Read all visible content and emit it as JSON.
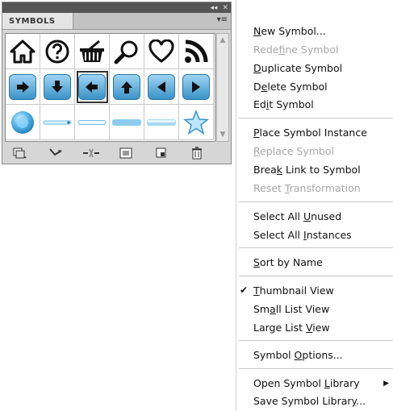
{
  "panel": {
    "chrome_controls": [
      "◂◂",
      "✕"
    ],
    "tab_label": "SYMBOLS",
    "menu_glyph": "▾≡"
  },
  "symbols": [
    "home-icon",
    "help-icon",
    "basket-icon",
    "magnifier-icon",
    "heart-icon",
    "rss-icon",
    "arrow-right-button",
    "arrow-down-button",
    "arrow-left-button",
    "arrow-up-button",
    "triangle-left-button",
    "triangle-right-button",
    "orb-symbol",
    "thin-line-dot",
    "thin-line",
    "thick-bar",
    "thick-bar-gloss",
    "star-symbol"
  ],
  "toolbar": [
    "library-icon",
    "place-icon",
    "break-link-icon",
    "options-icon",
    "new-icon",
    "delete-icon"
  ],
  "menu": {
    "groups": [
      [
        {
          "pre": "",
          "ul": "N",
          "post": "ew Symbol...",
          "disabled": false
        },
        {
          "pre": "Rede",
          "ul": "f",
          "post": "ine Symbol",
          "disabled": true
        },
        {
          "pre": "",
          "ul": "D",
          "post": "uplicate Symbol",
          "disabled": false
        },
        {
          "pre": "D",
          "ul": "e",
          "post": "lete Symbol",
          "disabled": false
        },
        {
          "pre": "Ed",
          "ul": "i",
          "post": "t Symbol",
          "disabled": false
        }
      ],
      [
        {
          "pre": "",
          "ul": "P",
          "post": "lace Symbol Instance",
          "disabled": false
        },
        {
          "pre": "",
          "ul": "R",
          "post": "eplace Symbol",
          "disabled": true
        },
        {
          "pre": "Brea",
          "ul": "k",
          "post": " Link to Symbol",
          "disabled": false
        },
        {
          "pre": "Reset ",
          "ul": "T",
          "post": "ransformation",
          "disabled": true
        }
      ],
      [
        {
          "pre": "Select All ",
          "ul": "U",
          "post": "nused",
          "disabled": false
        },
        {
          "pre": "Select All ",
          "ul": "I",
          "post": "nstances",
          "disabled": false
        }
      ],
      [
        {
          "pre": "",
          "ul": "S",
          "post": "ort by Name",
          "disabled": false
        }
      ],
      [
        {
          "pre": "",
          "ul": "T",
          "post": "humbnail View",
          "disabled": false,
          "checked": true
        },
        {
          "pre": "Sm",
          "ul": "a",
          "post": "ll List View",
          "disabled": false
        },
        {
          "pre": "Large List ",
          "ul": "V",
          "post": "iew",
          "disabled": false
        }
      ],
      [
        {
          "pre": "Symbol ",
          "ul": "O",
          "post": "ptions...",
          "disabled": false
        }
      ],
      [
        {
          "pre": "Open Symbol ",
          "ul": "L",
          "post": "ibrary",
          "disabled": false,
          "submenu": true
        },
        {
          "pre": "Save Symbol Librar",
          "ul": "y",
          "post": "...",
          "disabled": false
        }
      ]
    ],
    "check_glyph": "✔",
    "submenu_glyph": "▶"
  },
  "colors": {
    "accent_blue": "#3a93c9",
    "light_blue": "#9fd4f2",
    "disabled_text": "#a8a8a8"
  }
}
